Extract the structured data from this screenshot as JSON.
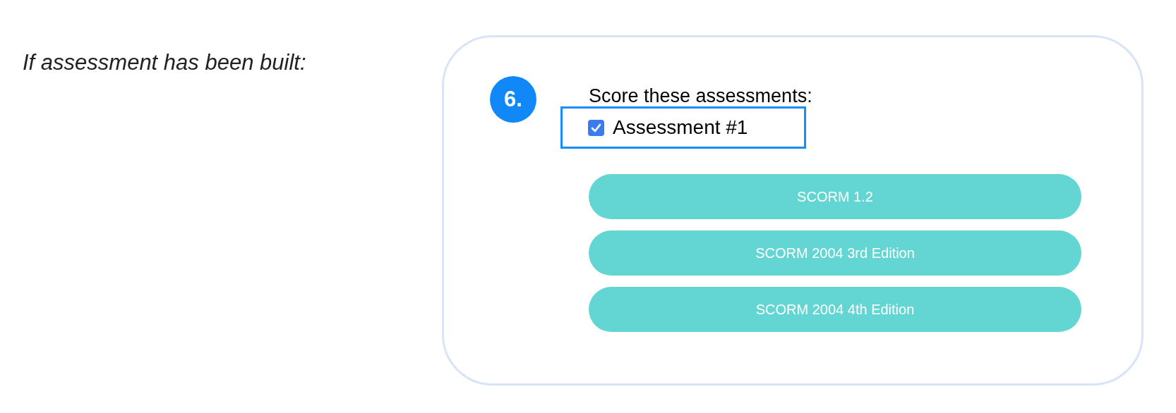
{
  "note": "If assessment has been built:",
  "step": {
    "number": "6.",
    "prompt": "Score these assessments:",
    "assessments": [
      {
        "label": "Assessment #1",
        "checked": true
      }
    ],
    "buttons": [
      "SCORM 1.2",
      "SCORM 2004 3rd Edition",
      "SCORM 2004 4th Edition"
    ]
  }
}
